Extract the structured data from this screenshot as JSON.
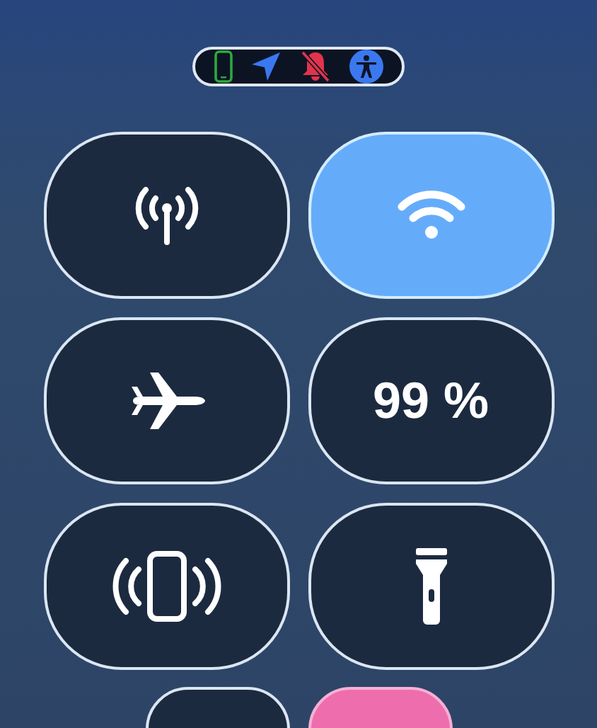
{
  "status_icons": [
    {
      "kind": "phone"
    },
    {
      "kind": "location"
    },
    {
      "kind": "bell-off"
    },
    {
      "kind": "accessibility"
    }
  ],
  "tiles": [
    {
      "kind": "cellular",
      "on": false
    },
    {
      "kind": "wifi",
      "on": true
    },
    {
      "kind": "airplane",
      "on": false
    },
    {
      "kind": "battery",
      "on": false,
      "text": "99 %"
    },
    {
      "kind": "vibrate",
      "on": false
    },
    {
      "kind": "flashlight",
      "on": false
    }
  ],
  "bottom_tiles": [
    {
      "on": false
    },
    {
      "on": true
    }
  ]
}
